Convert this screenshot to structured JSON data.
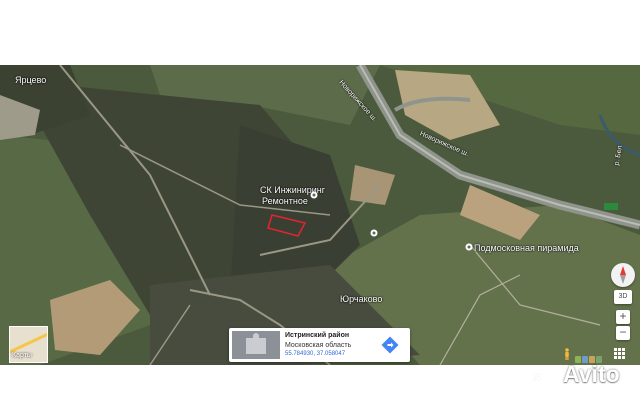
{
  "map": {
    "labels": {
      "village_top_left": "Ярцево",
      "sk_engineering": "СК Инжиниринг",
      "repair": "Ремонтное",
      "highway": "Новорижское ш.",
      "highway_segment": "Новорижское ш.",
      "pyramid": "Подмосковная пирамида",
      "yurcha": "Юрчаково",
      "river": "р. Бел",
      "road_km": "Е22"
    },
    "pins": [
      {
        "name": "sk-engineering-pin"
      },
      {
        "name": "field-pin"
      },
      {
        "name": "pyramid-pin"
      }
    ],
    "plot_outline_color": "#e8232e"
  },
  "info_card": {
    "title": "Истринский район",
    "region": "Московская область",
    "coords": "55.784930, 37.058047",
    "route_icon": "directions-icon"
  },
  "minimap": {
    "label": "Карты"
  },
  "controls": {
    "compass_icon": "compass-icon",
    "btn_3d": "3D",
    "zoom_in": "+",
    "zoom_out": "−",
    "pegman_icon": "pegman-icon"
  },
  "watermark": {
    "text": "Avito"
  }
}
